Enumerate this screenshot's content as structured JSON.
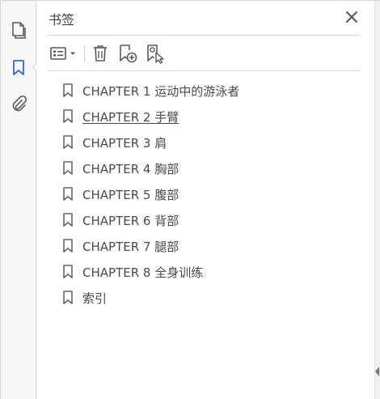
{
  "panel": {
    "title": "书签"
  },
  "rail": {
    "items": [
      {
        "icon": "pages-icon",
        "active": false
      },
      {
        "icon": "bookmark-icon",
        "active": true
      },
      {
        "icon": "paperclip-icon",
        "active": false
      }
    ]
  },
  "toolbar": {
    "options_icon": "options-menu-icon",
    "delete_icon": "trash-icon",
    "new_bookmark_icon": "new-bookmark-icon",
    "find_bookmark_icon": "find-current-bookmark-icon"
  },
  "bookmarks": [
    {
      "label": "CHAPTER 1  运动中的游泳者",
      "hover": false
    },
    {
      "label": "CHAPTER 2  手臂",
      "hover": true
    },
    {
      "label": "CHAPTER 3  肩",
      "hover": false
    },
    {
      "label": "CHAPTER 4  胸部",
      "hover": false
    },
    {
      "label": "CHAPTER 5  腹部",
      "hover": false
    },
    {
      "label": "CHAPTER 6  背部",
      "hover": false
    },
    {
      "label": "CHAPTER 7  腿部",
      "hover": false
    },
    {
      "label": "CHAPTER 8  全身训练",
      "hover": false
    },
    {
      "label": "索引",
      "hover": false
    }
  ],
  "colors": {
    "accent": "#2a6fd6",
    "icon": "#5a5a5a",
    "text": "#4a4a4a"
  }
}
